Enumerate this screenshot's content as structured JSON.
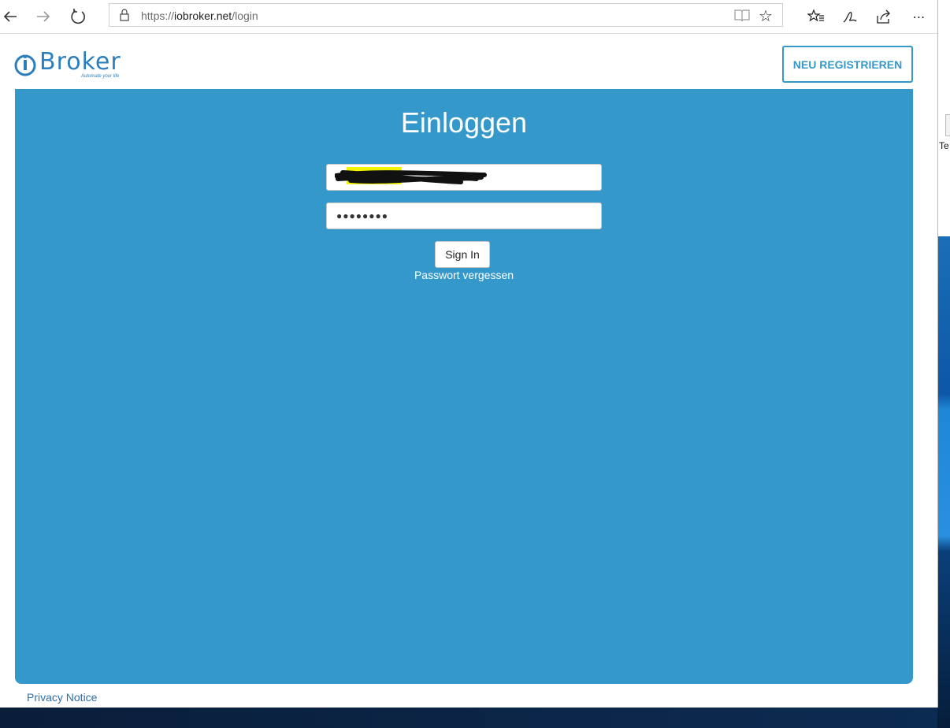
{
  "browser": {
    "url_prefix": "https://",
    "url_domain": "iobroker.net",
    "url_path": "/login"
  },
  "header": {
    "logo_text": "Broker",
    "logo_tagline": "Automate your life",
    "register_label": "NEU REGISTRIEREN"
  },
  "login": {
    "title": "Einloggen",
    "password_masked": "●●●●●●●●",
    "signin_label": "Sign In",
    "forgot_label": "Passwort vergessen"
  },
  "footer": {
    "privacy_label": "Privacy Notice"
  },
  "desktop": {
    "icon_label": "Te"
  },
  "colors": {
    "panel": "#3498cb",
    "accent": "#3498cb",
    "link": "#2b6fb0"
  }
}
